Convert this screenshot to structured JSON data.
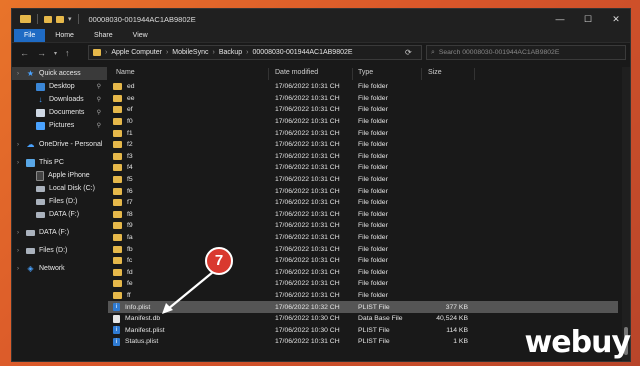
{
  "window": {
    "title": "00008030-001944AC1AB9802E",
    "controls": [
      "—",
      "☐",
      "✕"
    ]
  },
  "ribbon": {
    "tabs": [
      "File",
      "Home",
      "Share",
      "View"
    ]
  },
  "address": {
    "crumbs": [
      "Apple Computer",
      "MobileSync",
      "Backup",
      "00008030-001944AC1AB9802E"
    ],
    "search_placeholder": "Search 00008030-001944AC1AB9802E"
  },
  "nav": [
    {
      "label": "Quick access",
      "icon": "star-icon",
      "selected": true
    },
    {
      "label": "Desktop",
      "icon": "desktop-icon",
      "pinned": true
    },
    {
      "label": "Downloads",
      "icon": "download-icon",
      "pinned": true
    },
    {
      "label": "Documents",
      "icon": "documents-icon",
      "pinned": true
    },
    {
      "label": "Pictures",
      "icon": "pictures-icon",
      "pinned": true
    },
    {
      "label": "OneDrive - Personal",
      "icon": "cloud-icon"
    },
    {
      "label": "This PC",
      "icon": "pc-icon"
    },
    {
      "label": "Apple iPhone",
      "icon": "phone-icon"
    },
    {
      "label": "Local Disk (C:)",
      "icon": "drive-icon"
    },
    {
      "label": "Files (D:)",
      "icon": "drive-icon"
    },
    {
      "label": "DATA (F:)",
      "icon": "drive-icon"
    },
    {
      "label": "DATA (F:)",
      "icon": "drive-icon"
    },
    {
      "label": "Files (D:)",
      "icon": "drive-icon"
    },
    {
      "label": "Network",
      "icon": "network-icon"
    }
  ],
  "columns": {
    "name": "Name",
    "date": "Date modified",
    "type": "Type",
    "size": "Size"
  },
  "files": [
    {
      "name": "ed",
      "date": "17/06/2022 10:31 CH",
      "type": "File folder",
      "size": "",
      "kind": "folder"
    },
    {
      "name": "ee",
      "date": "17/06/2022 10:31 CH",
      "type": "File folder",
      "size": "",
      "kind": "folder"
    },
    {
      "name": "ef",
      "date": "17/06/2022 10:31 CH",
      "type": "File folder",
      "size": "",
      "kind": "folder"
    },
    {
      "name": "f0",
      "date": "17/06/2022 10:31 CH",
      "type": "File folder",
      "size": "",
      "kind": "folder"
    },
    {
      "name": "f1",
      "date": "17/06/2022 10:31 CH",
      "type": "File folder",
      "size": "",
      "kind": "folder"
    },
    {
      "name": "f2",
      "date": "17/06/2022 10:31 CH",
      "type": "File folder",
      "size": "",
      "kind": "folder"
    },
    {
      "name": "f3",
      "date": "17/06/2022 10:31 CH",
      "type": "File folder",
      "size": "",
      "kind": "folder"
    },
    {
      "name": "f4",
      "date": "17/06/2022 10:31 CH",
      "type": "File folder",
      "size": "",
      "kind": "folder"
    },
    {
      "name": "f5",
      "date": "17/06/2022 10:31 CH",
      "type": "File folder",
      "size": "",
      "kind": "folder"
    },
    {
      "name": "f6",
      "date": "17/06/2022 10:31 CH",
      "type": "File folder",
      "size": "",
      "kind": "folder"
    },
    {
      "name": "f7",
      "date": "17/06/2022 10:31 CH",
      "type": "File folder",
      "size": "",
      "kind": "folder"
    },
    {
      "name": "f8",
      "date": "17/06/2022 10:31 CH",
      "type": "File folder",
      "size": "",
      "kind": "folder"
    },
    {
      "name": "f9",
      "date": "17/06/2022 10:31 CH",
      "type": "File folder",
      "size": "",
      "kind": "folder"
    },
    {
      "name": "fa",
      "date": "17/06/2022 10:31 CH",
      "type": "File folder",
      "size": "",
      "kind": "folder"
    },
    {
      "name": "fb",
      "date": "17/06/2022 10:31 CH",
      "type": "File folder",
      "size": "",
      "kind": "folder"
    },
    {
      "name": "fc",
      "date": "17/06/2022 10:31 CH",
      "type": "File folder",
      "size": "",
      "kind": "folder"
    },
    {
      "name": "fd",
      "date": "17/06/2022 10:31 CH",
      "type": "File folder",
      "size": "",
      "kind": "folder"
    },
    {
      "name": "fe",
      "date": "17/06/2022 10:31 CH",
      "type": "File folder",
      "size": "",
      "kind": "folder"
    },
    {
      "name": "ff",
      "date": "17/06/2022 10:31 CH",
      "type": "File folder",
      "size": "",
      "kind": "folder"
    },
    {
      "name": "Info.plist",
      "date": "17/06/2022 10:32 CH",
      "type": "PLIST File",
      "size": "377 KB",
      "kind": "plist",
      "highlight": true
    },
    {
      "name": "Manifest.db",
      "date": "17/06/2022 10:30 CH",
      "type": "Data Base File",
      "size": "40,524 KB",
      "kind": "db"
    },
    {
      "name": "Manifest.plist",
      "date": "17/06/2022 10:30 CH",
      "type": "PLIST File",
      "size": "114 KB",
      "kind": "plist"
    },
    {
      "name": "Status.plist",
      "date": "17/06/2022 10:31 CH",
      "type": "PLIST File",
      "size": "1 KB",
      "kind": "plist"
    }
  ],
  "annotation": {
    "number": "7"
  },
  "watermark": "Webuy"
}
